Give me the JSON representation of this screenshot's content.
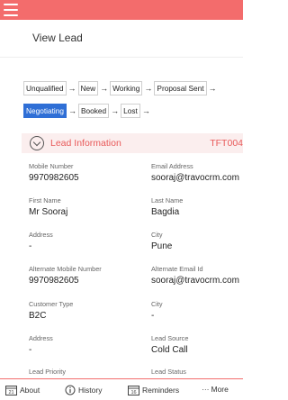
{
  "header": {
    "title": "View Lead"
  },
  "pipeline": {
    "row1": [
      "Unqualified",
      "New",
      "Working",
      "Proposal Sent"
    ],
    "row2": [
      "Negotiating",
      "Booked",
      "Lost"
    ],
    "active": "Negotiating",
    "arrow": "→"
  },
  "section": {
    "title": "Lead Information",
    "code": "TFT004"
  },
  "fields": [
    {
      "label": "Mobile Number",
      "value": "9970982605"
    },
    {
      "label": "Email Address",
      "value": "sooraj@travocrm.com"
    },
    {
      "label": "First Name",
      "value": "Mr Sooraj"
    },
    {
      "label": "Last Name",
      "value": "Bagdia"
    },
    {
      "label": "Address",
      "value": "-"
    },
    {
      "label": "City",
      "value": "Pune"
    },
    {
      "label": "Alternate Mobile Number",
      "value": "9970982605"
    },
    {
      "label": "Alternate Email Id",
      "value": "sooraj@travocrm.com"
    },
    {
      "label": "Customer Type",
      "value": "B2C"
    },
    {
      "label": "City",
      "value": "-"
    },
    {
      "label": "Address",
      "value": "-"
    },
    {
      "label": "Lead Source",
      "value": "Cold Call"
    },
    {
      "label": "Lead Priority",
      "value": ""
    },
    {
      "label": "Lead Status",
      "value": ""
    }
  ],
  "bottom_nav": [
    {
      "label": "About",
      "icon": "calendar-21-icon"
    },
    {
      "label": "History",
      "icon": "info-icon"
    },
    {
      "label": "Reminders",
      "icon": "calendar-16-icon"
    },
    {
      "label": "More",
      "icon": "dots-icon",
      "prefix": "···"
    }
  ],
  "colors": {
    "accent": "#f36c6c",
    "active_stage": "#2f6fd6",
    "section_bg": "#fbeeee",
    "section_text": "#e85a5a"
  }
}
